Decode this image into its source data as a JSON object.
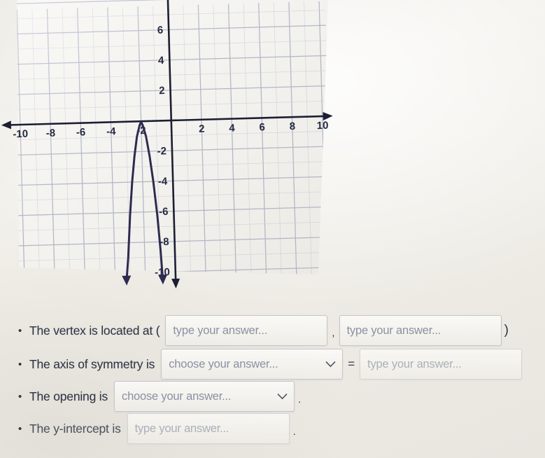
{
  "colors": {
    "paper": "#efede7",
    "grid_minor": "#b9bfd0",
    "grid_major": "#8e97b0",
    "axis": "#1c1f33",
    "curve": "#2e2b4f",
    "text": "#2e3444",
    "placeholder": "#8a91a3",
    "field_border": "#c3c6cc"
  },
  "chart_data": {
    "type": "line",
    "title": "",
    "xlabel": "",
    "ylabel": "",
    "xlim": [
      -11,
      11
    ],
    "ylim": [
      -11,
      7
    ],
    "grid": true,
    "legend": null,
    "x_tick_labels": [
      "-10",
      "-8",
      "-6",
      "-4",
      "-2",
      "2",
      "4",
      "6",
      "8",
      "10"
    ],
    "x_ticks": [
      -10,
      -8,
      -6,
      -4,
      -2,
      2,
      4,
      6,
      8,
      10
    ],
    "y_tick_labels": [
      "6",
      "4",
      "2",
      "-2",
      "-4",
      "-6",
      "-8",
      "-10"
    ],
    "y_ticks": [
      6,
      4,
      2,
      -2,
      -4,
      -6,
      -8,
      -10
    ],
    "description": "Downward-opening parabola with vertex at (-2, 0) on graph paper",
    "vertex": [
      -2,
      0
    ],
    "opening": "down",
    "axis_of_symmetry": "x = -2",
    "series": [
      {
        "name": "parabola",
        "color": "#2e2b4f",
        "points": [
          [
            -3.25,
            -10.5
          ],
          [
            -3.1,
            -9.0
          ],
          [
            -2.9,
            -6.2
          ],
          [
            -2.7,
            -4.0
          ],
          [
            -2.5,
            -2.3
          ],
          [
            -2.3,
            -1.0
          ],
          [
            -2.1,
            -0.25
          ],
          [
            -2.0,
            -0.05
          ],
          [
            -1.9,
            -0.25
          ],
          [
            -1.7,
            -1.0
          ],
          [
            -1.5,
            -2.3
          ],
          [
            -1.3,
            -4.0
          ],
          [
            -1.1,
            -6.2
          ],
          [
            -0.95,
            -8.5
          ],
          [
            -0.85,
            -10.5
          ]
        ]
      }
    ]
  },
  "questions": [
    {
      "id": "vertex",
      "bullet": "•",
      "label": "The vertex is located at (",
      "x_field_placeholder": "type your answer...",
      "separator": ",",
      "y_field_placeholder": "type your answer...",
      "closing": ")"
    },
    {
      "id": "axis-of-symmetry",
      "bullet": "•",
      "label": "The axis of symmetry is",
      "select_placeholder": "choose your answer...",
      "equals": "=",
      "field_placeholder": "type your answer..."
    },
    {
      "id": "opening",
      "bullet": "•",
      "label": "The opening is",
      "select_placeholder": "choose your answer...",
      "period": "."
    },
    {
      "id": "y-intercept",
      "bullet": "•",
      "label": "The y-intercept is",
      "field_placeholder": "type your answer...",
      "period": "."
    }
  ]
}
